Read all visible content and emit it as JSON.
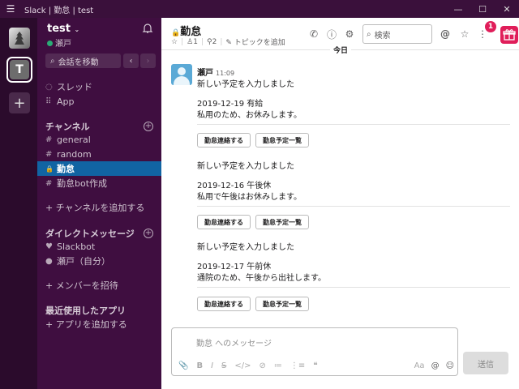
{
  "window": {
    "title": "Slack | 勤怠 | test",
    "menu_icon": "☰",
    "minimize": "—",
    "maximize": "☐",
    "close": "✕"
  },
  "rail": {
    "workspace_t_label": "T",
    "add_label": "+"
  },
  "sidebar": {
    "team_name": "test",
    "team_chevron": "⌄",
    "user_name": "瀬戸",
    "jump_label": "会話を移動",
    "jump_icon": "⌕",
    "back": "‹",
    "forward": "›",
    "threads": {
      "icon": "◌",
      "label": "スレッド"
    },
    "apps": {
      "icon": "⠿",
      "label": "App"
    },
    "channels_header": "チャンネル",
    "channels": [
      {
        "prefix": "#",
        "name": "general"
      },
      {
        "prefix": "#",
        "name": "random"
      },
      {
        "prefix": "🔒",
        "name": "勤怠"
      },
      {
        "prefix": "#",
        "name": "勤怠bot作成"
      }
    ],
    "add_channel": "+ チャンネルを追加する",
    "dm_header": "ダイレクトメッセージ",
    "dms": [
      {
        "prefix": "♥",
        "name": "Slackbot"
      },
      {
        "prefix": "●",
        "name": "瀬戸（自分）"
      }
    ],
    "invite": "+ メンバーを招待",
    "recent_apps_header": "最近使用したアプリ",
    "add_app": "+ アプリを追加する",
    "plus": "+"
  },
  "channel": {
    "name": "勤怠",
    "lock": "🔒",
    "star": "☆",
    "members": "1",
    "member_icon": "♙",
    "pins": "2",
    "pin_icon": "⚲",
    "topic_icon": "✎",
    "topic_label": "トピックを追加",
    "search_placeholder": "検索",
    "search_icon": "⌕",
    "mention_icon": "@",
    "star_icon": "☆",
    "more_icon": "⋮",
    "notification_count": "1",
    "phone_icon": "✆",
    "info_icon": "ⓘ",
    "settings_icon": "⚙",
    "gift_icon": "🎁"
  },
  "date_divider": "今日",
  "message": {
    "sender": "瀬戸",
    "time": "11:09",
    "blocks": [
      {
        "intro": "新しい予定を入力しました",
        "date": "2019-12-19 有給",
        "note": "私用のため、お休みします。"
      },
      {
        "intro": "新しい予定を入力しました",
        "date": "2019-12-16 午後休",
        "note": "私用で午後はお休みします。"
      },
      {
        "intro": "新しい予定を入力しました",
        "date": "2019-12-17 午前休",
        "note": "通院のため、午後から出社します。"
      }
    ],
    "btn_contact": "勤怠連絡する",
    "btn_list": "勤怠予定一覧"
  },
  "composer": {
    "placeholder": "勤怠 へのメッセージ",
    "attach_icon": "📎",
    "format_icons": [
      "B",
      "I",
      "S",
      "</>",
      "⊘",
      "≔",
      "⋮≡",
      "❝"
    ],
    "aa": "Aa",
    "at": "@",
    "emoji": "☺",
    "send_label": "送信"
  }
}
